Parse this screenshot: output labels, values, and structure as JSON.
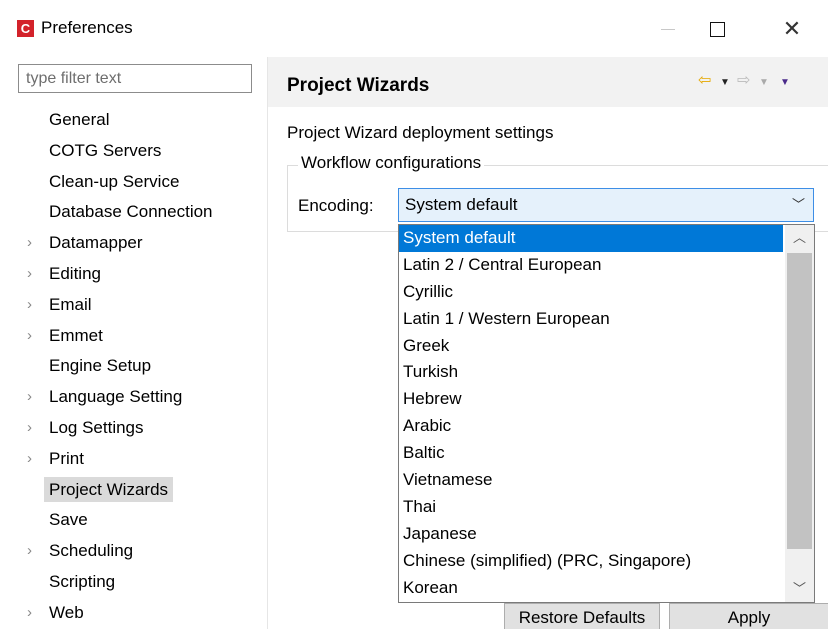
{
  "window": {
    "title": "Preferences",
    "app_icon_letter": "C",
    "minimize_icon": "minimize-icon",
    "maximize_icon": "maximize-icon",
    "close_glyph": "✕"
  },
  "sidebar": {
    "filter_placeholder": "type filter text",
    "items": [
      {
        "label": "General",
        "expandable": false
      },
      {
        "label": "COTG Servers",
        "expandable": false
      },
      {
        "label": "Clean-up Service",
        "expandable": false
      },
      {
        "label": "Database Connection",
        "expandable": false
      },
      {
        "label": "Datamapper",
        "expandable": true
      },
      {
        "label": "Editing",
        "expandable": true
      },
      {
        "label": "Email",
        "expandable": true
      },
      {
        "label": "Emmet",
        "expandable": true
      },
      {
        "label": "Engine Setup",
        "expandable": false
      },
      {
        "label": "Language Setting",
        "expandable": true
      },
      {
        "label": "Log Settings",
        "expandable": true
      },
      {
        "label": "Print",
        "expandable": true
      },
      {
        "label": "Project Wizards",
        "expandable": false,
        "selected": true
      },
      {
        "label": "Save",
        "expandable": false
      },
      {
        "label": "Scheduling",
        "expandable": true
      },
      {
        "label": "Scripting",
        "expandable": false
      },
      {
        "label": "Web",
        "expandable": true
      }
    ]
  },
  "page": {
    "title": "Project Wizards",
    "description": "Project Wizard deployment settings",
    "group_label": "Workflow configurations",
    "encoding_label": "Encoding:",
    "encoding_value": "System default"
  },
  "encoding_options": [
    "System default",
    "Latin 2 / Central European",
    "Cyrillic",
    "Latin 1 / Western European",
    "Greek",
    "Turkish",
    "Hebrew",
    "Arabic",
    "Baltic",
    "Vietnamese",
    "Thai",
    "Japanese",
    "Chinese (simplified) (PRC, Singapore)",
    "Korean"
  ],
  "buttons": {
    "restore_defaults": "Restore Defaults",
    "apply": "Apply"
  },
  "colors": {
    "app_icon": "#d3222a",
    "selection": "#0078d7",
    "nav_back_arrow": "#e6a800"
  }
}
